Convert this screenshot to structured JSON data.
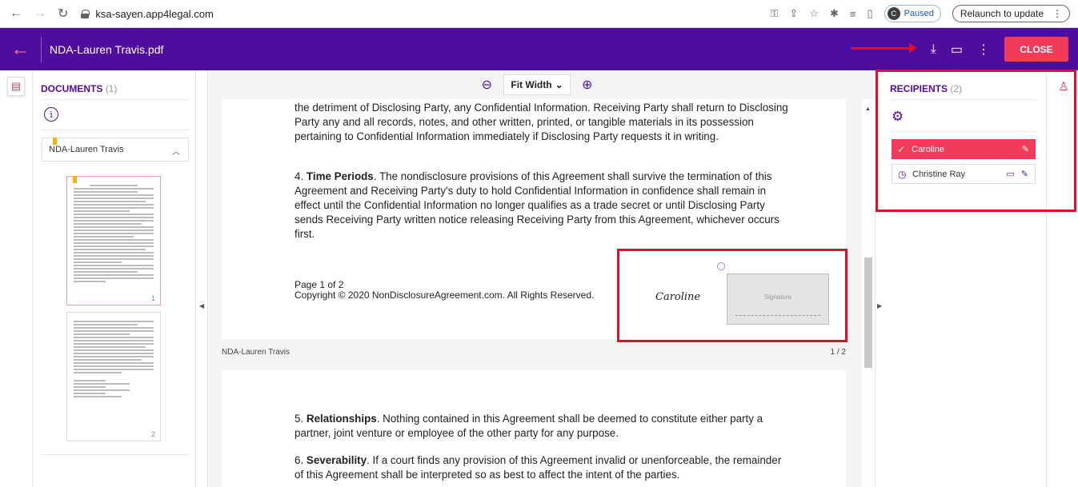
{
  "browser": {
    "url": "ksa-sayen.app4legal.com",
    "profile_initial": "C",
    "profile_status": "Paused",
    "relaunch_label": "Relaunch to update"
  },
  "app": {
    "file_title": "NDA-Lauren Travis.pdf",
    "close_label": "CLOSE"
  },
  "documents": {
    "heading": "DOCUMENTS",
    "count": "(1)",
    "items": [
      {
        "name": "NDA-Lauren Travis"
      }
    ],
    "thumbnails": [
      {
        "page": "1"
      },
      {
        "page": "2"
      }
    ]
  },
  "viewer": {
    "zoom_mode": "Fit Width",
    "page1": {
      "para_a": "the detriment of Disclosing Party, any Confidential Information. Receiving Party shall return to Disclosing Party any and all records, notes, and other written, printed, or tangible materials in its possession pertaining to Confidential Information immediately if Disclosing Party requests it in writing.",
      "para_b_num": "4.",
      "para_b_head": "Time Periods",
      "para_b_body": ". The nondisclosure provisions of this Agreement shall survive the termination of this Agreement and Receiving Party's duty to hold Confidential Information in confidence shall remain in effect until the Confidential Information no longer qualifies as a trade secret or until Disclosing Party sends Receiving Party written notice releasing Receiving Party from this Agreement, whichever occurs first.",
      "footer_page": "Page 1 of 2",
      "footer_copyright": "Copyright © 2020 NonDisclosureAgreement.com. All Rights Reserved."
    },
    "signature": {
      "script": "Caroline",
      "field_label": "Signature"
    },
    "page_meta": {
      "doc_name": "NDA-Lauren Travis",
      "page_indicator": "1 / 2"
    },
    "page2": {
      "para_a_num": "5.",
      "para_a_head": "Relationships",
      "para_a_body": ". Nothing contained in this Agreement shall be deemed to constitute either party a partner, joint venture or employee of the other party for any purpose.",
      "para_b_num": "6.",
      "para_b_head": "Severability",
      "para_b_body": ". If a court finds any provision of this Agreement invalid or unenforceable, the remainder of this Agreement shall be interpreted so as best to affect the intent of the parties."
    }
  },
  "recipients": {
    "heading": "RECIPIENTS",
    "count": "(2)",
    "items": [
      {
        "name": "Caroline",
        "status": "signed"
      },
      {
        "name": "Christine Ray",
        "status": "pending"
      }
    ]
  },
  "colors": {
    "brand": "#4f0d9e",
    "accent": "#f23a5a",
    "highlight": "#e0102d"
  }
}
